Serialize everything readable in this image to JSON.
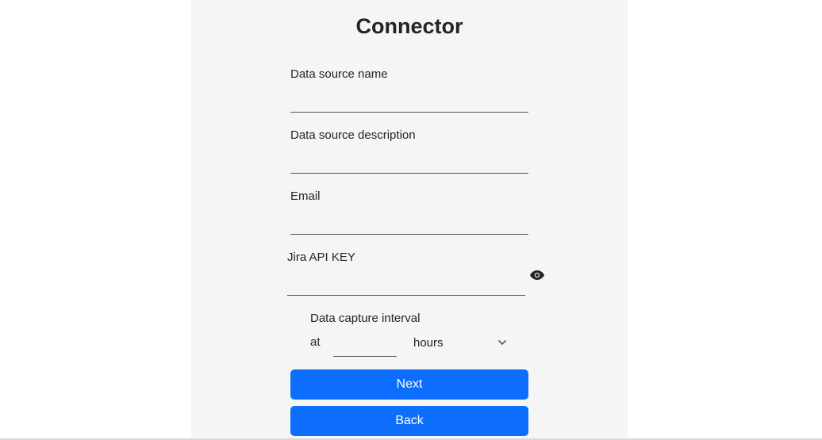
{
  "form": {
    "title": "Connector",
    "fields": {
      "name": {
        "label": "Data source name",
        "value": ""
      },
      "description": {
        "label": "Data source description",
        "value": ""
      },
      "email": {
        "label": "Email",
        "value": ""
      },
      "api_key": {
        "label": "Jira API KEY",
        "value": ""
      }
    },
    "interval": {
      "label": "Data capture interval",
      "at_label": "at",
      "value": "",
      "unit_selected": "hours"
    },
    "buttons": {
      "next": "Next",
      "back": "Back"
    }
  },
  "icons": {
    "password_toggle": "eye-icon",
    "dropdown": "chevron-down-icon"
  },
  "colors": {
    "primary": "#0d6efd",
    "panel_bg": "#f5f5f5"
  }
}
